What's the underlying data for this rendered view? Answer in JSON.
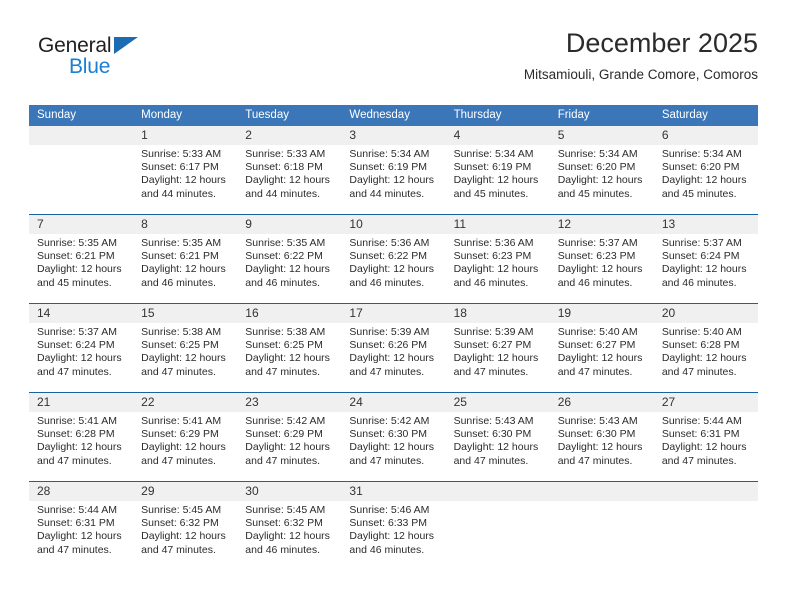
{
  "logo": {
    "word_one": "General",
    "word_two": "Blue",
    "triangle_icon": "blue-triangle-icon",
    "brand_color": "#1b7fd4"
  },
  "header": {
    "title": "December 2025",
    "subtitle": "Mitsamiouli, Grande Comore, Comoros"
  },
  "theme": {
    "header_bg": "#3a76b8",
    "header_text": "#ffffff",
    "row_divider": "#19619f",
    "daynum_bg": "#f0f0f0",
    "body_text": "#2b2b2b"
  },
  "calendar": {
    "weekday_headers": [
      "Sunday",
      "Monday",
      "Tuesday",
      "Wednesday",
      "Thursday",
      "Friday",
      "Saturday"
    ],
    "weeks": [
      [
        {
          "day": "",
          "sunrise": "",
          "sunset": "",
          "daylight_line1": "",
          "daylight_line2": ""
        },
        {
          "day": "1",
          "sunrise": "Sunrise: 5:33 AM",
          "sunset": "Sunset: 6:17 PM",
          "daylight_line1": "Daylight: 12 hours",
          "daylight_line2": "and 44 minutes."
        },
        {
          "day": "2",
          "sunrise": "Sunrise: 5:33 AM",
          "sunset": "Sunset: 6:18 PM",
          "daylight_line1": "Daylight: 12 hours",
          "daylight_line2": "and 44 minutes."
        },
        {
          "day": "3",
          "sunrise": "Sunrise: 5:34 AM",
          "sunset": "Sunset: 6:19 PM",
          "daylight_line1": "Daylight: 12 hours",
          "daylight_line2": "and 44 minutes."
        },
        {
          "day": "4",
          "sunrise": "Sunrise: 5:34 AM",
          "sunset": "Sunset: 6:19 PM",
          "daylight_line1": "Daylight: 12 hours",
          "daylight_line2": "and 45 minutes."
        },
        {
          "day": "5",
          "sunrise": "Sunrise: 5:34 AM",
          "sunset": "Sunset: 6:20 PM",
          "daylight_line1": "Daylight: 12 hours",
          "daylight_line2": "and 45 minutes."
        },
        {
          "day": "6",
          "sunrise": "Sunrise: 5:34 AM",
          "sunset": "Sunset: 6:20 PM",
          "daylight_line1": "Daylight: 12 hours",
          "daylight_line2": "and 45 minutes."
        }
      ],
      [
        {
          "day": "7",
          "sunrise": "Sunrise: 5:35 AM",
          "sunset": "Sunset: 6:21 PM",
          "daylight_line1": "Daylight: 12 hours",
          "daylight_line2": "and 45 minutes."
        },
        {
          "day": "8",
          "sunrise": "Sunrise: 5:35 AM",
          "sunset": "Sunset: 6:21 PM",
          "daylight_line1": "Daylight: 12 hours",
          "daylight_line2": "and 46 minutes."
        },
        {
          "day": "9",
          "sunrise": "Sunrise: 5:35 AM",
          "sunset": "Sunset: 6:22 PM",
          "daylight_line1": "Daylight: 12 hours",
          "daylight_line2": "and 46 minutes."
        },
        {
          "day": "10",
          "sunrise": "Sunrise: 5:36 AM",
          "sunset": "Sunset: 6:22 PM",
          "daylight_line1": "Daylight: 12 hours",
          "daylight_line2": "and 46 minutes."
        },
        {
          "day": "11",
          "sunrise": "Sunrise: 5:36 AM",
          "sunset": "Sunset: 6:23 PM",
          "daylight_line1": "Daylight: 12 hours",
          "daylight_line2": "and 46 minutes."
        },
        {
          "day": "12",
          "sunrise": "Sunrise: 5:37 AM",
          "sunset": "Sunset: 6:23 PM",
          "daylight_line1": "Daylight: 12 hours",
          "daylight_line2": "and 46 minutes."
        },
        {
          "day": "13",
          "sunrise": "Sunrise: 5:37 AM",
          "sunset": "Sunset: 6:24 PM",
          "daylight_line1": "Daylight: 12 hours",
          "daylight_line2": "and 46 minutes."
        }
      ],
      [
        {
          "day": "14",
          "sunrise": "Sunrise: 5:37 AM",
          "sunset": "Sunset: 6:24 PM",
          "daylight_line1": "Daylight: 12 hours",
          "daylight_line2": "and 47 minutes."
        },
        {
          "day": "15",
          "sunrise": "Sunrise: 5:38 AM",
          "sunset": "Sunset: 6:25 PM",
          "daylight_line1": "Daylight: 12 hours",
          "daylight_line2": "and 47 minutes."
        },
        {
          "day": "16",
          "sunrise": "Sunrise: 5:38 AM",
          "sunset": "Sunset: 6:25 PM",
          "daylight_line1": "Daylight: 12 hours",
          "daylight_line2": "and 47 minutes."
        },
        {
          "day": "17",
          "sunrise": "Sunrise: 5:39 AM",
          "sunset": "Sunset: 6:26 PM",
          "daylight_line1": "Daylight: 12 hours",
          "daylight_line2": "and 47 minutes."
        },
        {
          "day": "18",
          "sunrise": "Sunrise: 5:39 AM",
          "sunset": "Sunset: 6:27 PM",
          "daylight_line1": "Daylight: 12 hours",
          "daylight_line2": "and 47 minutes."
        },
        {
          "day": "19",
          "sunrise": "Sunrise: 5:40 AM",
          "sunset": "Sunset: 6:27 PM",
          "daylight_line1": "Daylight: 12 hours",
          "daylight_line2": "and 47 minutes."
        },
        {
          "day": "20",
          "sunrise": "Sunrise: 5:40 AM",
          "sunset": "Sunset: 6:28 PM",
          "daylight_line1": "Daylight: 12 hours",
          "daylight_line2": "and 47 minutes."
        }
      ],
      [
        {
          "day": "21",
          "sunrise": "Sunrise: 5:41 AM",
          "sunset": "Sunset: 6:28 PM",
          "daylight_line1": "Daylight: 12 hours",
          "daylight_line2": "and 47 minutes."
        },
        {
          "day": "22",
          "sunrise": "Sunrise: 5:41 AM",
          "sunset": "Sunset: 6:29 PM",
          "daylight_line1": "Daylight: 12 hours",
          "daylight_line2": "and 47 minutes."
        },
        {
          "day": "23",
          "sunrise": "Sunrise: 5:42 AM",
          "sunset": "Sunset: 6:29 PM",
          "daylight_line1": "Daylight: 12 hours",
          "daylight_line2": "and 47 minutes."
        },
        {
          "day": "24",
          "sunrise": "Sunrise: 5:42 AM",
          "sunset": "Sunset: 6:30 PM",
          "daylight_line1": "Daylight: 12 hours",
          "daylight_line2": "and 47 minutes."
        },
        {
          "day": "25",
          "sunrise": "Sunrise: 5:43 AM",
          "sunset": "Sunset: 6:30 PM",
          "daylight_line1": "Daylight: 12 hours",
          "daylight_line2": "and 47 minutes."
        },
        {
          "day": "26",
          "sunrise": "Sunrise: 5:43 AM",
          "sunset": "Sunset: 6:30 PM",
          "daylight_line1": "Daylight: 12 hours",
          "daylight_line2": "and 47 minutes."
        },
        {
          "day": "27",
          "sunrise": "Sunrise: 5:44 AM",
          "sunset": "Sunset: 6:31 PM",
          "daylight_line1": "Daylight: 12 hours",
          "daylight_line2": "and 47 minutes."
        }
      ],
      [
        {
          "day": "28",
          "sunrise": "Sunrise: 5:44 AM",
          "sunset": "Sunset: 6:31 PM",
          "daylight_line1": "Daylight: 12 hours",
          "daylight_line2": "and 47 minutes."
        },
        {
          "day": "29",
          "sunrise": "Sunrise: 5:45 AM",
          "sunset": "Sunset: 6:32 PM",
          "daylight_line1": "Daylight: 12 hours",
          "daylight_line2": "and 47 minutes."
        },
        {
          "day": "30",
          "sunrise": "Sunrise: 5:45 AM",
          "sunset": "Sunset: 6:32 PM",
          "daylight_line1": "Daylight: 12 hours",
          "daylight_line2": "and 46 minutes."
        },
        {
          "day": "31",
          "sunrise": "Sunrise: 5:46 AM",
          "sunset": "Sunset: 6:33 PM",
          "daylight_line1": "Daylight: 12 hours",
          "daylight_line2": "and 46 minutes."
        },
        {
          "day": "",
          "sunrise": "",
          "sunset": "",
          "daylight_line1": "",
          "daylight_line2": ""
        },
        {
          "day": "",
          "sunrise": "",
          "sunset": "",
          "daylight_line1": "",
          "daylight_line2": ""
        },
        {
          "day": "",
          "sunrise": "",
          "sunset": "",
          "daylight_line1": "",
          "daylight_line2": ""
        }
      ]
    ]
  }
}
